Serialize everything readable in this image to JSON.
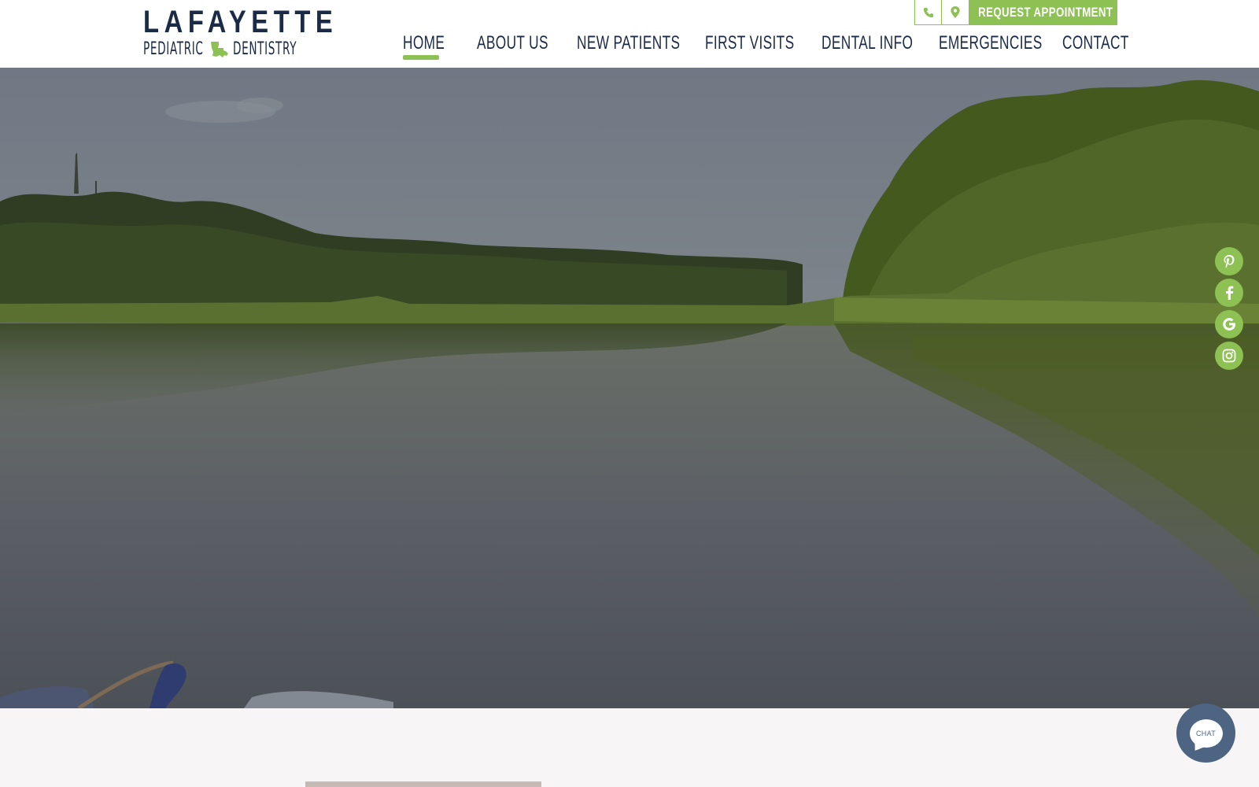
{
  "brand": {
    "name_top": "LAFAYETTE",
    "name_left": "PEDIATRIC",
    "name_right": "DENTISTRY",
    "state_icon": "louisiana-state-icon"
  },
  "utility_bar": {
    "phone_icon": "phone-icon",
    "location_icon": "map-pin-icon",
    "appointment_icon": "calendar-icon",
    "appointment_label": "REQUEST APPOINTMENT"
  },
  "nav": {
    "items": [
      {
        "label": "HOME",
        "active": true
      },
      {
        "label": "ABOUT US",
        "active": false
      },
      {
        "label": "NEW PATIENTS",
        "active": false
      },
      {
        "label": "FIRST VISITS",
        "active": false
      },
      {
        "label": "DENTAL INFO",
        "active": false
      },
      {
        "label": "EMERGENCIES",
        "active": false
      },
      {
        "label": "CONTACT",
        "active": false
      }
    ]
  },
  "hero": {
    "image": "river-landscape-photo"
  },
  "social": [
    {
      "icon": "pinterest-icon"
    },
    {
      "icon": "facebook-icon"
    },
    {
      "icon": "google-icon"
    },
    {
      "icon": "instagram-icon"
    }
  ],
  "chat": {
    "label": "CHAT",
    "icon": "chat-bubble-icon"
  },
  "colors": {
    "accent": "#8dc153",
    "navy": "#1b2a46",
    "chat_bg": "#4d6582",
    "section_bg": "#f7f5f5"
  }
}
